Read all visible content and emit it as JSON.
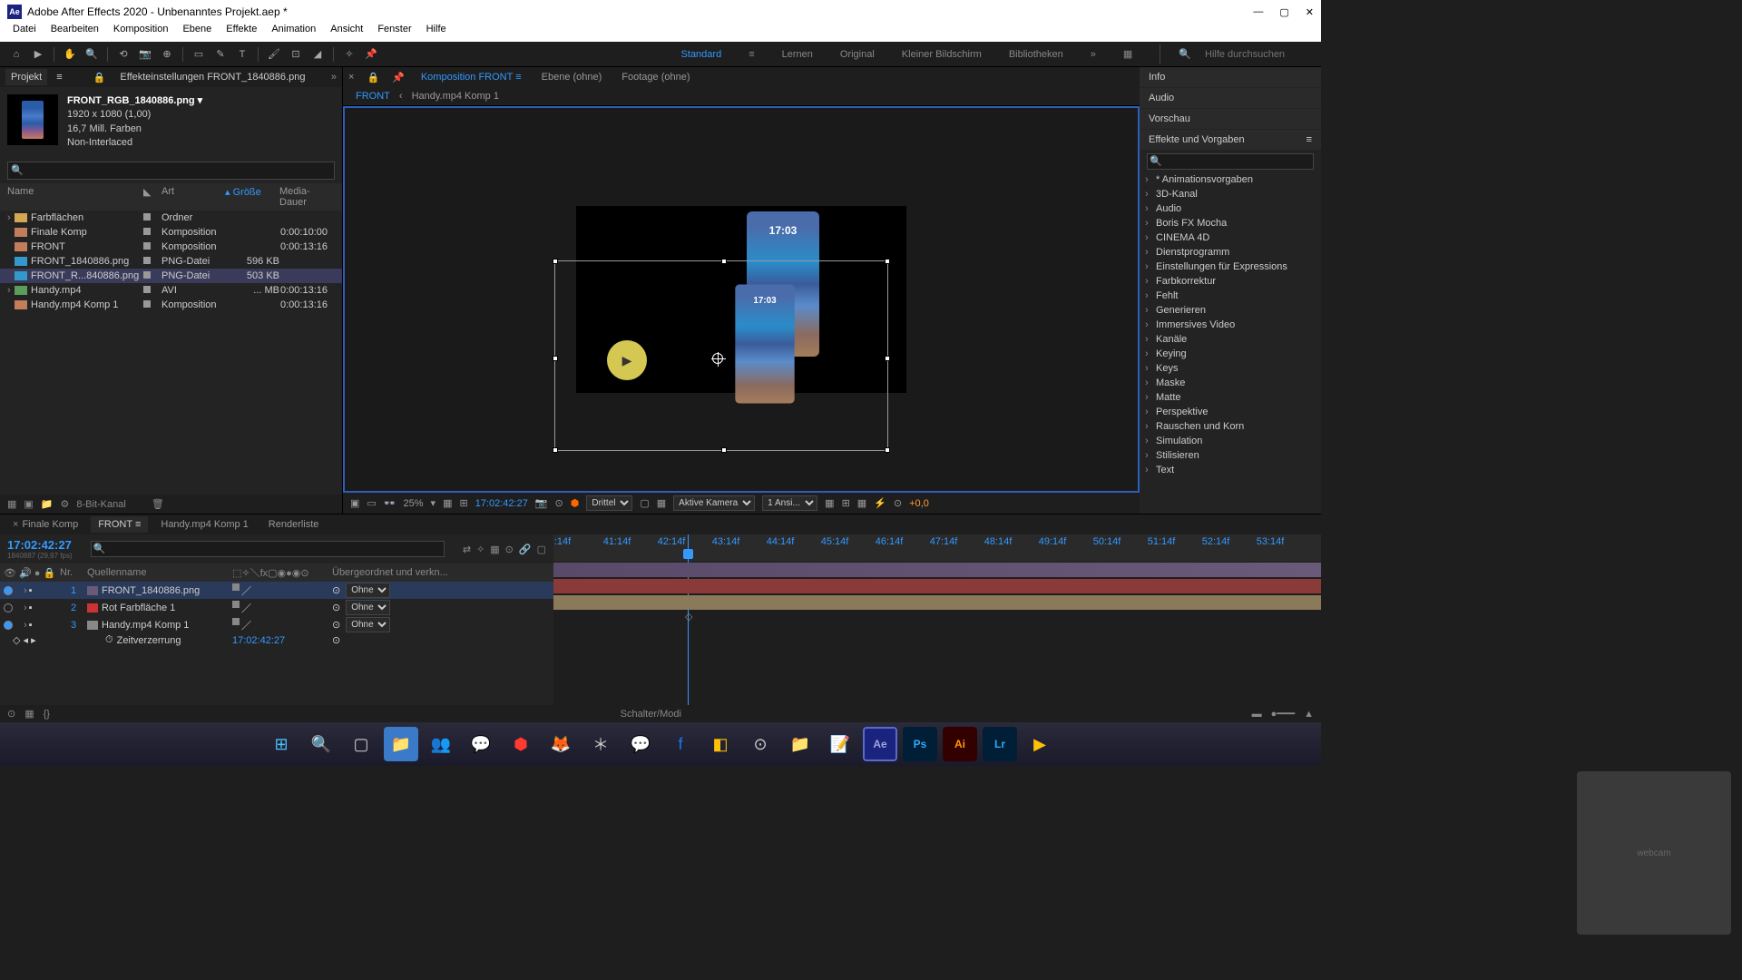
{
  "titlebar": {
    "app_icon": "Ae",
    "title": "Adobe After Effects 2020 - Unbenanntes Projekt.aep *"
  },
  "menubar": [
    "Datei",
    "Bearbeiten",
    "Komposition",
    "Ebene",
    "Effekte",
    "Animation",
    "Ansicht",
    "Fenster",
    "Hilfe"
  ],
  "workspaces": {
    "items": [
      "Standard",
      "Lernen",
      "Original",
      "Kleiner Bildschirm",
      "Bibliotheken"
    ],
    "active": "Standard",
    "search_placeholder": "Hilfe durchsuchen"
  },
  "panels": {
    "project_tab": "Projekt",
    "effect_settings_prefix": "Effekteinstellungen",
    "effect_settings_file": "FRONT_1840886.png"
  },
  "project": {
    "selected": {
      "name": "FRONT_RGB_1840886.png",
      "dims": "1920 x 1080 (1,00)",
      "colors": "16,7 Mill. Farben",
      "interlace": "Non-Interlaced"
    },
    "columns": {
      "name": "Name",
      "label": "",
      "art": "Art",
      "size": "Größe",
      "dur": "Media-Dauer"
    },
    "rows": [
      {
        "icon": "folder",
        "name": "Farbflächen",
        "art": "Ordner",
        "size": "",
        "dur": ""
      },
      {
        "icon": "comp",
        "name": "Finale Komp",
        "art": "Komposition",
        "size": "",
        "dur": "0:00:10:00"
      },
      {
        "icon": "comp",
        "name": "FRONT",
        "art": "Komposition",
        "size": "",
        "dur": "0:00:13:16"
      },
      {
        "icon": "png",
        "name": "FRONT_1840886.png",
        "art": "PNG-Datei",
        "size": "596 KB",
        "dur": ""
      },
      {
        "icon": "png",
        "name": "FRONT_R...840886.png",
        "art": "PNG-Datei",
        "size": "503 KB",
        "dur": "",
        "sel": true
      },
      {
        "icon": "avi",
        "name": "Handy.mp4",
        "art": "AVI",
        "size": "... MB",
        "dur": "0:00:13:16"
      },
      {
        "icon": "comp",
        "name": "Handy.mp4 Komp 1",
        "art": "Komposition",
        "size": "",
        "dur": "0:00:13:16"
      }
    ],
    "footer_bpc": "8-Bit-Kanal"
  },
  "composition": {
    "tab_prefix": "Komposition",
    "tab_name": "FRONT",
    "layer_tab": "Ebene  (ohne)",
    "footage_tab": "Footage  (ohne)",
    "flow": [
      "FRONT",
      "Handy.mp4 Komp 1"
    ],
    "phone_time": "17:03"
  },
  "viewport_footer": {
    "zoom": "25%",
    "timecode": "17:02:42:27",
    "quality": "Drittel",
    "camera": "Aktive Kamera",
    "views": "1 Ansi...",
    "exposure": "+0,0"
  },
  "right_panel": {
    "sections": [
      "Info",
      "Audio",
      "Vorschau"
    ],
    "effects_header": "Effekte und Vorgaben",
    "categories": [
      "* Animationsvorgaben",
      "3D-Kanal",
      "Audio",
      "Boris FX Mocha",
      "CINEMA 4D",
      "Dienstprogramm",
      "Einstellungen für Expressions",
      "Farbkorrektur",
      "Fehlt",
      "Generieren",
      "Immersives Video",
      "Kanäle",
      "Keying",
      "Keys",
      "Maske",
      "Matte",
      "Perspektive",
      "Rauschen und Korn",
      "Simulation",
      "Stilisieren",
      "Text"
    ]
  },
  "timeline": {
    "tabs": [
      {
        "label": "Finale Komp",
        "active": false,
        "close": true
      },
      {
        "label": "FRONT",
        "active": true,
        "close": false
      },
      {
        "label": "Handy.mp4 Komp 1",
        "active": false,
        "close": false
      },
      {
        "label": "Renderliste",
        "active": false,
        "close": false
      }
    ],
    "timecode": "17:02:42:27",
    "frames": "1840887 (29,97 fps)",
    "cols": {
      "nr": "Nr.",
      "source": "Quellenname",
      "parent": "Übergeordnet und verkn..."
    },
    "layers": [
      {
        "nr": "1",
        "icon": "png",
        "name": "FRONT_1840886.png",
        "parent": "Ohne",
        "eye": true,
        "sel": true,
        "color": "#6a5a7a"
      },
      {
        "nr": "2",
        "icon": "solid",
        "name": "Rot Farbfläche 1",
        "parent": "Ohne",
        "eye": false,
        "sel": false,
        "color": "#cc3333"
      },
      {
        "nr": "3",
        "icon": "comp",
        "name": "Handy.mp4 Komp 1",
        "parent": "Ohne",
        "eye": true,
        "sel": false,
        "color": "#888"
      }
    ],
    "time_remap": {
      "label": "Zeitverzerrung",
      "value": "17:02:42:27"
    },
    "ruler_ticks": [
      ":14f",
      "41:14f",
      "42:14f",
      "43:14f",
      "44:14f",
      "45:14f",
      "46:14f",
      "47:14f",
      "48:14f",
      "49:14f",
      "50:14f",
      "51:14f",
      "52:14f",
      "53:14f"
    ],
    "footer_modi": "Schalter/Modi"
  }
}
